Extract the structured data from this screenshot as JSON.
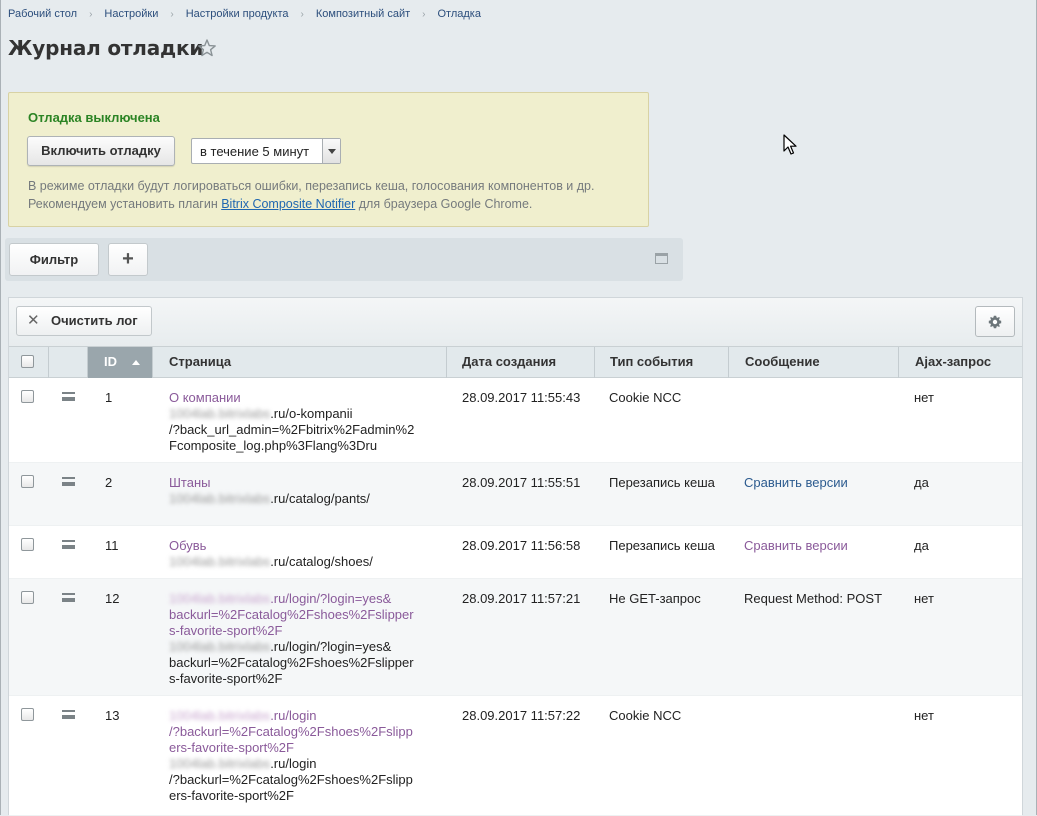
{
  "breadcrumb": [
    "Рабочий стол",
    "Настройки",
    "Настройки продукта",
    "Композитный сайт",
    "Отладка"
  ],
  "page_title": "Журнал отладки",
  "debug": {
    "status": "Отладка выключена",
    "enable_button": "Включить отладку",
    "duration": "в течение 5 минут",
    "note_line1": "В режиме отладки будут логироваться ошибки, перезапись кеша, голосования компонентов и др.",
    "note_line2_before": "Рекомендуем установить плагин ",
    "note_link": "Bitrix Composite Notifier",
    "note_line2_after": " для браузера Google Chrome."
  },
  "filter": {
    "filter_button": "Фильтр",
    "add_button": "+"
  },
  "grid": {
    "clear_button": "Очистить лог",
    "columns": {
      "id": "ID",
      "page": "Страница",
      "date": "Дата создания",
      "type": "Тип события",
      "message": "Сообщение",
      "ajax": "Ajax-запрос"
    },
    "rows": [
      {
        "id": "1",
        "page_title": "О компании",
        "host": "1004lab.bitrixlabs",
        "url": [
          ".ru/o-kompanii",
          "/?back_url_admin=%2Fbitrix%2Fadmin%2",
          "Fcomposite_log.php%3Flang%3Dru"
        ],
        "date": "28.09.2017 11:55:43",
        "type": "Cookie NCC",
        "message": "",
        "ajax": "нет"
      },
      {
        "id": "2",
        "page_title": "Штаны",
        "host": "1004lab.bitrixlabs",
        "url": [
          ".ru/catalog/pants/"
        ],
        "date": "28.09.2017 11:55:51",
        "type": "Перезапись кеша",
        "message": "Сравнить версии",
        "ajax": "да"
      },
      {
        "id": "11",
        "page_title": "Обувь",
        "host": "1004lab.bitrixlabs",
        "url": [
          ".ru/catalog/shoes/"
        ],
        "date": "28.09.2017 11:56:58",
        "type": "Перезапись кеша",
        "message": "Сравнить версии",
        "ajax": "да"
      },
      {
        "id": "12",
        "title_host": "1004lab.bitrixlabs",
        "title_url": [
          ".ru/login/?login=yes&",
          "backurl=%2Fcatalog%2Fshoes%2Fslipper",
          "s-favorite-sport%2F"
        ],
        "host": "1004lab.bitrixlabs",
        "url": [
          ".ru/login/?login=yes&",
          "backurl=%2Fcatalog%2Fshoes%2Fslipper",
          "s-favorite-sport%2F"
        ],
        "date": "28.09.2017 11:57:21",
        "type": "Не GET-запрос",
        "message": "Request Method: POST",
        "ajax": "нет"
      },
      {
        "id": "13",
        "title_host": "1004lab.bitrixlabs",
        "title_url": [
          ".ru/login",
          "/?backurl=%2Fcatalog%2Fshoes%2Fslipp",
          "ers-favorite-sport%2F"
        ],
        "host": "1004lab.bitrixlabs",
        "url": [
          ".ru/login",
          "/?backurl=%2Fcatalog%2Fshoes%2Fslipp",
          "ers-favorite-sport%2F"
        ],
        "date": "28.09.2017 11:57:22",
        "type": "Cookie NCC",
        "message": "",
        "ajax": "нет"
      }
    ]
  }
}
